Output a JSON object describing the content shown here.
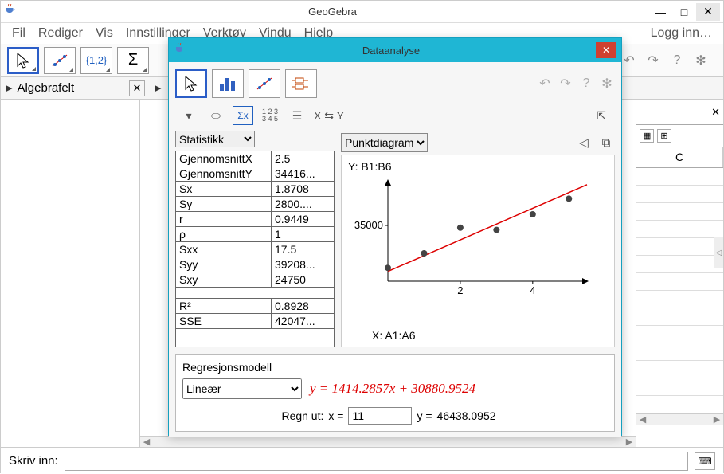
{
  "window": {
    "title": "GeoGebra",
    "login": "Logg inn…"
  },
  "menu": {
    "file": "Fil",
    "edit": "Rediger",
    "view": "Vis",
    "settings": "Innstillinger",
    "tools": "Verktøy",
    "window": "Vindu",
    "help": "Hjelp"
  },
  "toolbar": {
    "set_label": "{1,2}",
    "sigma_label": "Σ"
  },
  "panels": {
    "algebra": "Algebrafelt"
  },
  "input": {
    "label": "Skriv inn:",
    "value": ""
  },
  "spreadsheet": {
    "col_c": "C"
  },
  "dialog": {
    "title": "Dataanalyse",
    "stats_dropdown": "Statistikk",
    "chart_dropdown": "Punktdiagram",
    "regression_title": "Regresjonsmodell",
    "regression_type": "Lineær",
    "equation": "y = 1414.2857x + 30880.9524",
    "calc_label": "Regn ut:",
    "x_letter": "x =",
    "x_value": "11",
    "y_letter": "y =",
    "y_value": "46438.0952",
    "y_axis_label": "Y:  B1:B6",
    "x_axis_label": "X:  A1:A6",
    "toolbar2_xy": "X ⇆ Y"
  },
  "stats": [
    {
      "k": "GjennomsnittX",
      "v": "2.5"
    },
    {
      "k": "GjennomsnittY",
      "v": "34416..."
    },
    {
      "k": "Sx",
      "v": "1.8708"
    },
    {
      "k": "Sy",
      "v": "2800...."
    },
    {
      "k": "r",
      "v": "0.9449"
    },
    {
      "k": "ρ",
      "v": "1"
    },
    {
      "k": "Sxx",
      "v": "17.5"
    },
    {
      "k": "Syy",
      "v": "39208..."
    },
    {
      "k": "Sxy",
      "v": "24750"
    }
  ],
  "stats2": [
    {
      "k": "R²",
      "v": "0.8928"
    },
    {
      "k": "SSE",
      "v": "42047..."
    }
  ],
  "chart_data": {
    "type": "scatter",
    "title": "",
    "xlabel": "X:  A1:A6",
    "ylabel": "Y:  B1:B6",
    "x_ticks": [
      2,
      4
    ],
    "y_ticks": [
      35000
    ],
    "xlim": [
      0,
      5.5
    ],
    "ylim": [
      30000,
      39000
    ],
    "points": [
      {
        "x": 0,
        "y": 31200
      },
      {
        "x": 1,
        "y": 32500
      },
      {
        "x": 2,
        "y": 34800
      },
      {
        "x": 3,
        "y": 34600
      },
      {
        "x": 4,
        "y": 36000
      },
      {
        "x": 5,
        "y": 37400
      }
    ],
    "regression": {
      "slope": 1414.2857,
      "intercept": 30880.9524
    }
  }
}
